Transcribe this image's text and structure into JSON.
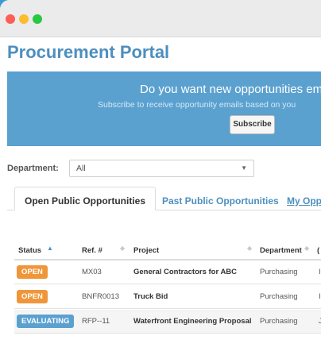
{
  "window": {
    "controls": [
      "close",
      "minimize",
      "maximize"
    ]
  },
  "page_title": "Procurement Portal",
  "banner": {
    "heading": "Do you want new opportunities emai",
    "subtext": "Subscribe to receive opportunity emails based on you",
    "subscribe_label": "Subscribe"
  },
  "filter": {
    "label": "Department:",
    "value": "All"
  },
  "tabs": [
    {
      "label": "Open Public Opportunities",
      "active": true
    },
    {
      "label": "Past Public Opportunities",
      "active": false
    },
    {
      "label": "My Opp",
      "active": false
    }
  ],
  "table": {
    "headers": [
      "Status",
      "Ref. #",
      "Project",
      "Department",
      "("
    ],
    "rows": [
      {
        "status": "OPEN",
        "ref": "MX03",
        "project": "General Contractors for ABC",
        "department": "Purchasing",
        "extra": "I"
      },
      {
        "status": "OPEN",
        "ref": "BNFR0013",
        "project": "Truck Bid",
        "department": "Purchasing",
        "extra": "I"
      },
      {
        "status": "EVALUATING",
        "ref": "RFP--11",
        "project": "Waterfront  Engineering Proposal",
        "department": "Purchasing",
        "extra": "J"
      }
    ]
  },
  "colors": {
    "accent": "#4d8fbe",
    "banner_bg": "#5ba1d0",
    "status_open": "#f0963a",
    "status_evaluating": "#5ba1d0"
  }
}
